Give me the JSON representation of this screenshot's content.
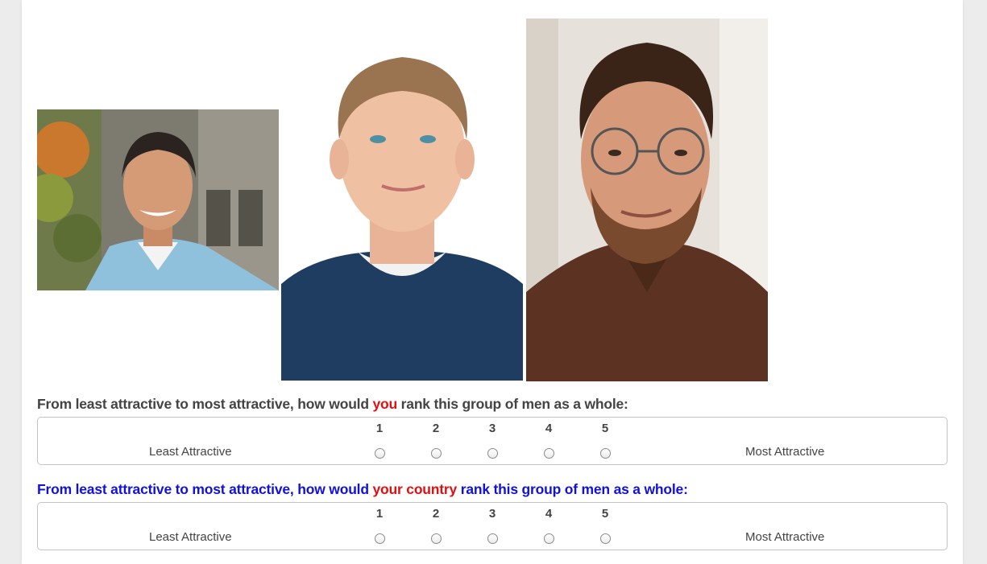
{
  "photos": [
    {
      "name": "photo-man-dark-hair-smiling",
      "alt": "Man with dark hair smiling"
    },
    {
      "name": "photo-young-man-blond",
      "alt": "Young blond man"
    },
    {
      "name": "photo-man-glasses-beard",
      "alt": "Man with glasses and beard"
    }
  ],
  "questions": [
    {
      "prefix": "From least attractive to most attractive, how would ",
      "highlight": "you",
      "suffix": " rank this group of men as a whole:",
      "scale": {
        "numbers": [
          "1",
          "2",
          "3",
          "4",
          "5"
        ],
        "left_anchor": "Least Attractive",
        "right_anchor": "Most Attractive",
        "selected": null
      }
    },
    {
      "prefix": "From least attractive to most attractive, how would ",
      "highlight": "your country",
      "suffix": " rank this group of men as a whole:",
      "scale": {
        "numbers": [
          "1",
          "2",
          "3",
          "4",
          "5"
        ],
        "left_anchor": "Least Attractive",
        "right_anchor": "Most Attractive",
        "selected": null
      }
    }
  ],
  "colors": {
    "question1_text": "#444444",
    "question2_text": "#1111dd",
    "highlight": "#e01010",
    "page_background": "#ececec"
  }
}
